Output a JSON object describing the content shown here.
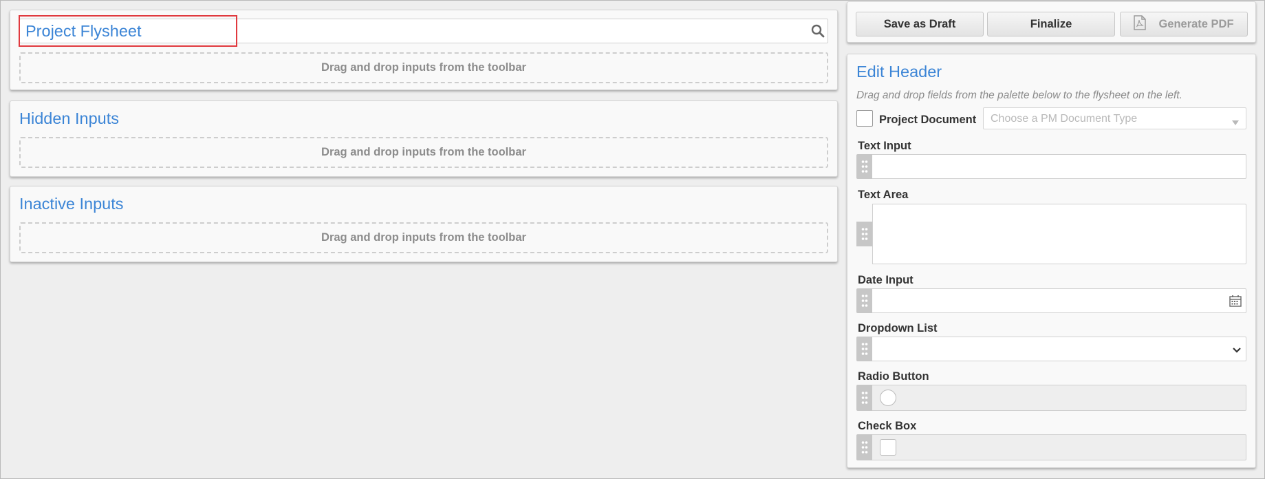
{
  "flysheet": {
    "title_value": "Project Flysheet",
    "dropzone_text": "Drag and drop inputs from the toolbar"
  },
  "hidden_inputs": {
    "title": "Hidden Inputs",
    "dropzone_text": "Drag and drop inputs from the toolbar"
  },
  "inactive_inputs": {
    "title": "Inactive Inputs",
    "dropzone_text": "Drag and drop inputs from the toolbar"
  },
  "toolbar": {
    "save_draft_label": "Save as Draft",
    "finalize_label": "Finalize",
    "generate_pdf_label": "Generate PDF"
  },
  "edit_header": {
    "title": "Edit Header",
    "hint": "Drag and drop fields from the palette below to the flysheet on the left.",
    "project_document_label": "Project Document",
    "document_type_placeholder": "Choose a PM Document Type",
    "palette": {
      "text_input": "Text Input",
      "text_area": "Text Area",
      "date_input": "Date Input",
      "dropdown_list": "Dropdown List",
      "radio_button": "Radio Button",
      "check_box": "Check Box"
    }
  },
  "icons": {
    "search": "search-icon",
    "pdf": "pdf-file-icon",
    "calendar": "calendar-icon",
    "chevron": "chevron-down-icon",
    "grip": "drag-handle-icon"
  },
  "colors": {
    "accent": "#3c85d6",
    "highlight": "#e0393e"
  }
}
